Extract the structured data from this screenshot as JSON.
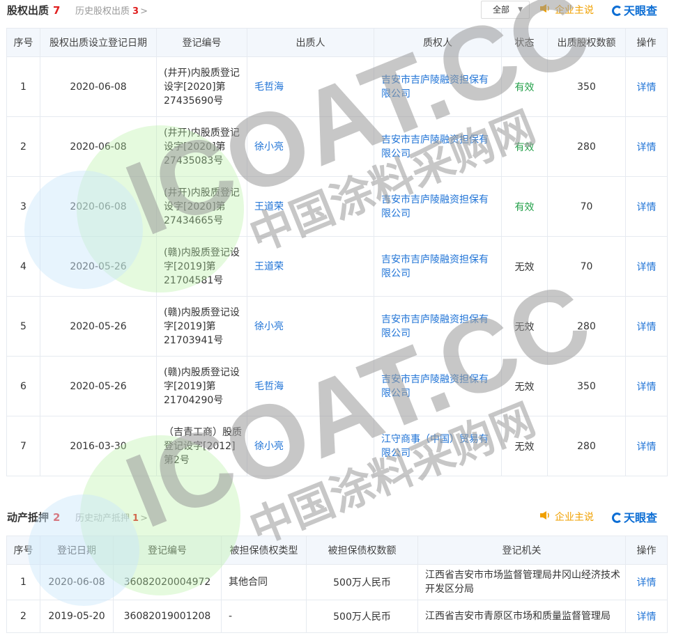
{
  "pledge": {
    "title": "股权出质",
    "count": "7",
    "history_label": "历史股权出质",
    "history_count": "3",
    "chevron": ">",
    "filter_value": "全部",
    "enterprise_link": "企业主说",
    "logo_text": "天眼查",
    "columns": [
      "序号",
      "股权出质设立登记日期",
      "登记编号",
      "出质人",
      "质权人",
      "状态",
      "出质股权数额",
      "操作"
    ],
    "rows": [
      {
        "no": "1",
        "date": "2020-06-08",
        "reg": "(井开)内股质登记设字[2020]第27435690号",
        "pledgor": "毛哲海",
        "pledgee": "吉安市吉庐陵融资担保有限公司",
        "status": "有效",
        "amount": "350",
        "action": "详情"
      },
      {
        "no": "2",
        "date": "2020-06-08",
        "reg": "(井开)内股质登记设字[2020]第27435083号",
        "pledgor": "徐小亮",
        "pledgee": "吉安市吉庐陵融资担保有限公司",
        "status": "有效",
        "amount": "280",
        "action": "详情"
      },
      {
        "no": "3",
        "date": "2020-06-08",
        "reg": "(井开)内股质登记设字[2020]第27434665号",
        "pledgor": "王道荣",
        "pledgee": "吉安市吉庐陵融资担保有限公司",
        "status": "有效",
        "amount": "70",
        "action": "详情"
      },
      {
        "no": "4",
        "date": "2020-05-26",
        "reg": "(赣)内股质登记设字[2019]第21704581号",
        "pledgor": "王道荣",
        "pledgee": "吉安市吉庐陵融资担保有限公司",
        "status": "无效",
        "amount": "70",
        "action": "详情"
      },
      {
        "no": "5",
        "date": "2020-05-26",
        "reg": "(赣)内股质登记设字[2019]第21703941号",
        "pledgor": "徐小亮",
        "pledgee": "吉安市吉庐陵融资担保有限公司",
        "status": "无效",
        "amount": "280",
        "action": "详情"
      },
      {
        "no": "6",
        "date": "2020-05-26",
        "reg": "(赣)内股质登记设字[2019]第21704290号",
        "pledgor": "毛哲海",
        "pledgee": "吉安市吉庐陵融资担保有限公司",
        "status": "无效",
        "amount": "350",
        "action": "详情"
      },
      {
        "no": "7",
        "date": "2016-03-30",
        "reg": "（吉青工商）股质登记设字[2012]第2号",
        "pledgor": "徐小亮",
        "pledgee": "江守商事（中国）贸易有限公司",
        "status": "无效",
        "amount": "280",
        "action": "详情"
      }
    ]
  },
  "mortgage": {
    "title": "动产抵押",
    "count": "2",
    "history_label": "历史动产抵押",
    "history_count": "1",
    "chevron": ">",
    "enterprise_link": "企业主说",
    "logo_text": "天眼查",
    "columns": [
      "序号",
      "登记日期",
      "登记编号",
      "被担保债权类型",
      "被担保债权数额",
      "登记机关",
      "操作"
    ],
    "rows": [
      {
        "no": "1",
        "date": "2020-06-08",
        "reg": "36082020004972",
        "type": "其他合同",
        "amount": "500万人民币",
        "authority": "江西省吉安市市场监督管理局井冈山经济技术开发区分局",
        "action": "详情"
      },
      {
        "no": "2",
        "date": "2019-05-20",
        "reg": "36082019001208",
        "type": "-",
        "amount": "500万人民币",
        "authority": "江西省吉安市青原区市场和质量监督管理局",
        "action": "详情"
      }
    ]
  },
  "watermark": {
    "text": "ICOAT.CC",
    "subtext": "中国涂料采购网",
    "colors": {
      "gray": "#9a9a9a",
      "green": "#b5f0a0",
      "blue": "#c9e6fa"
    }
  },
  "colors": {
    "link": "#1f73d6",
    "valid": "#24a04a",
    "count": "#e02020",
    "accent": "#f0a000",
    "header_bg": "#f3f7fc"
  }
}
